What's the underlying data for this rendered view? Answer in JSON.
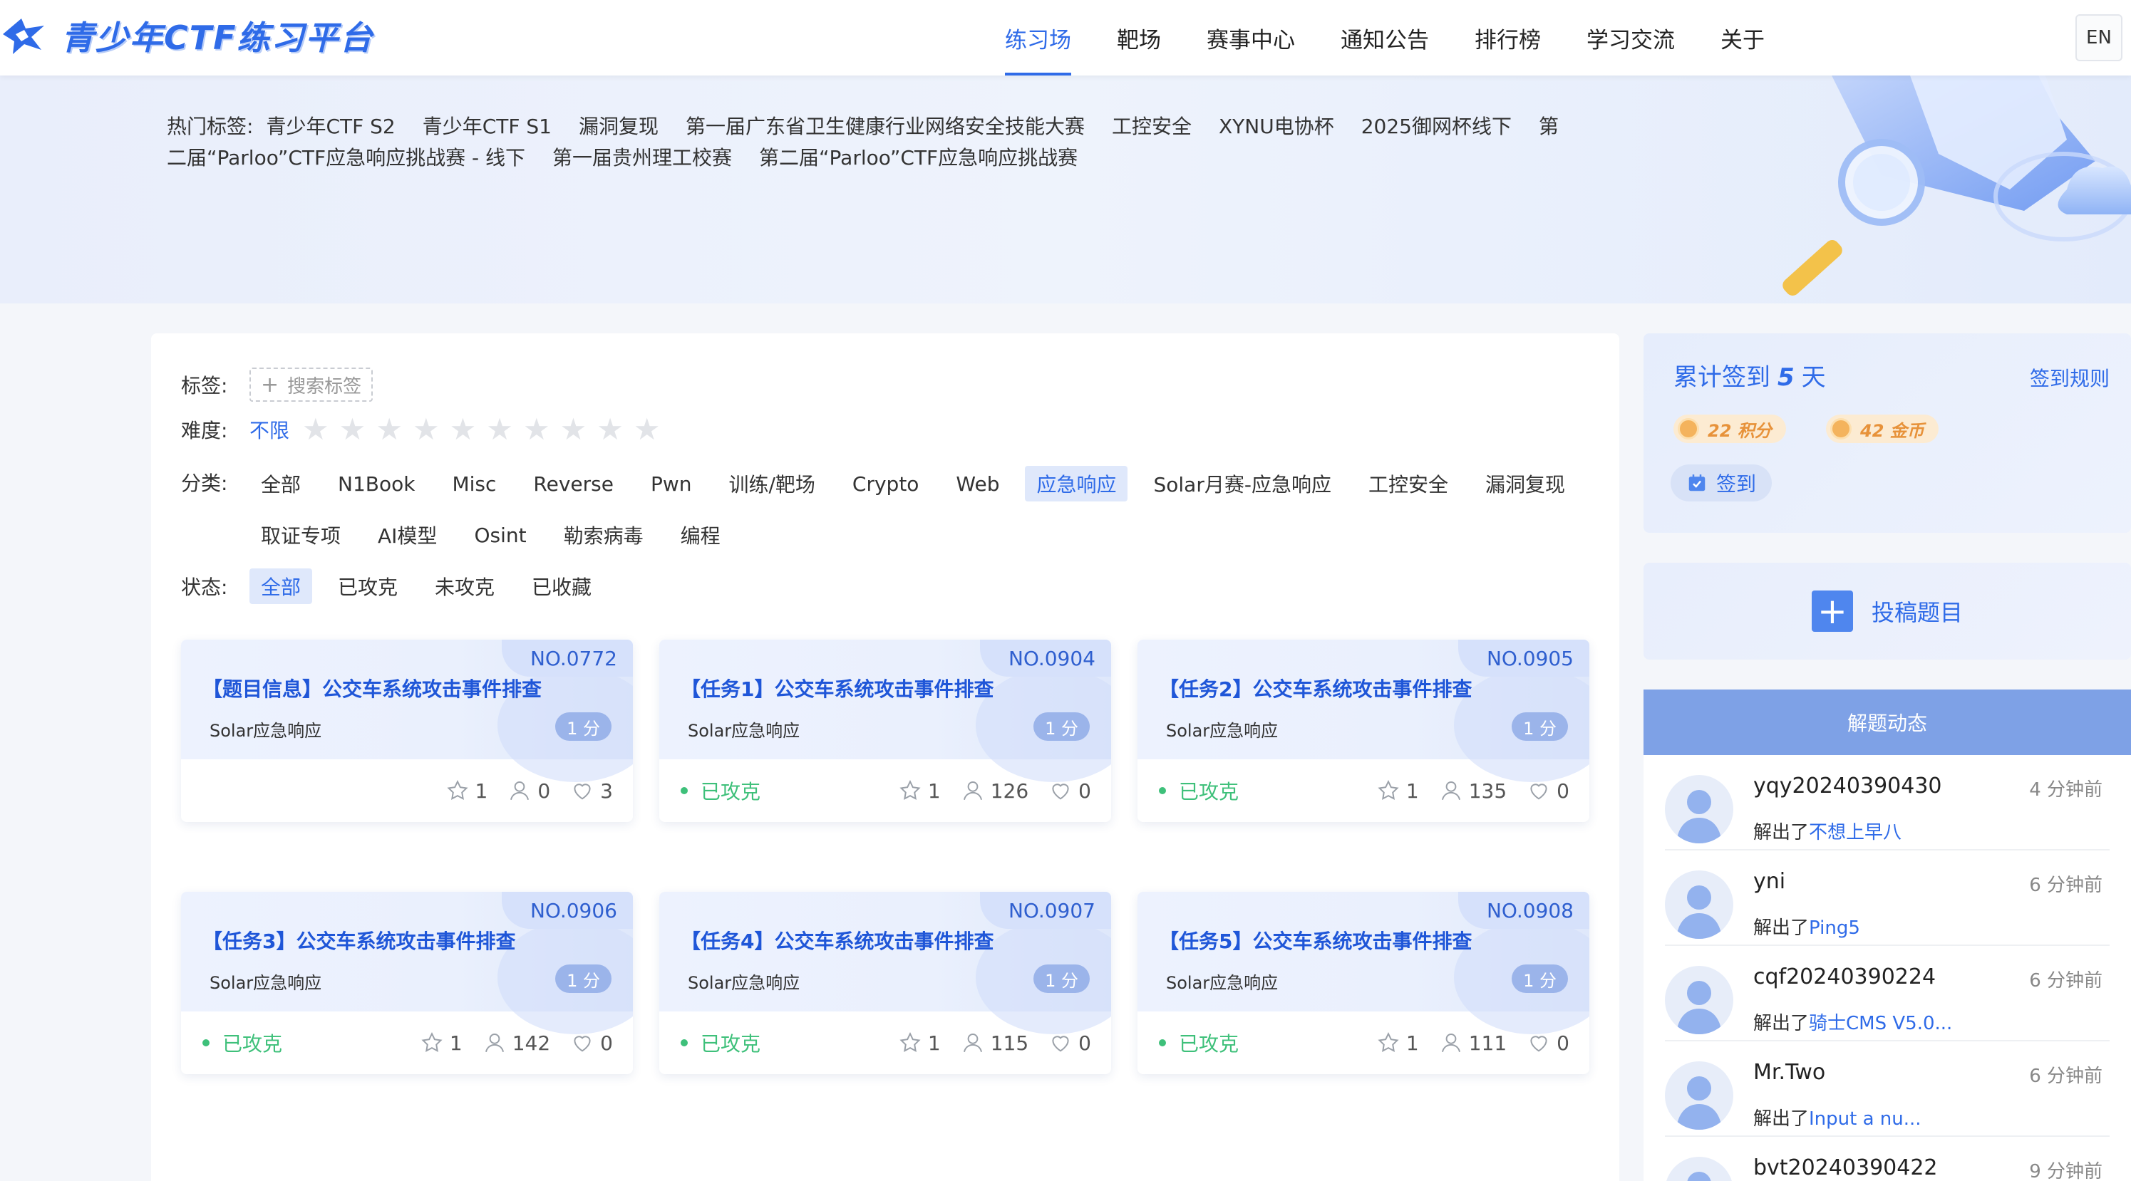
{
  "header": {
    "logo_text": "青少年CTF练习平台",
    "nav": [
      {
        "label": "练习场",
        "active": true
      },
      {
        "label": "靶场"
      },
      {
        "label": "赛事中心"
      },
      {
        "label": "通知公告"
      },
      {
        "label": "排行榜"
      },
      {
        "label": "学习交流"
      },
      {
        "label": "关于"
      }
    ],
    "lang": "EN"
  },
  "hot_tags": {
    "label": "热门标签:",
    "tags": [
      "青少年CTF S2",
      "青少年CTF S1",
      "漏洞复现",
      "第一届广东省卫生健康行业网络安全技能大赛",
      "工控安全",
      "XYNU电协杯",
      "2025御网杯线下",
      "第二届“Parloo”CTF应急响应挑战赛 - 线下",
      "第一届贵州理工校赛",
      "第二届“Parloo”CTF应急响应挑战赛"
    ]
  },
  "filters": {
    "tag_label": "标签:",
    "tag_search": "搜索标签",
    "difficulty_label": "难度:",
    "difficulty_any": "不限",
    "category_label": "分类:",
    "categories": [
      "全部",
      "N1Book",
      "Misc",
      "Reverse",
      "Pwn",
      "训练/靶场",
      "Crypto",
      "Web",
      "应急响应",
      "Solar月赛-应急响应",
      "工控安全",
      "漏洞复现",
      "取证专项",
      "AI模型",
      "Osint",
      "勒索病毒",
      "编程"
    ],
    "active_category": "应急响应",
    "status_label": "状态:",
    "statuses": [
      "全部",
      "已攻克",
      "未攻克",
      "已收藏"
    ],
    "active_status": "全部"
  },
  "cards": [
    {
      "no": "NO.0772",
      "title": "【题目信息】公交车系统攻击事件排查",
      "category": "Solar应急响应",
      "score": "1 分",
      "solved": "",
      "stars": "1",
      "users": "0",
      "likes": "3"
    },
    {
      "no": "NO.0904",
      "title": "【任务1】公交车系统攻击事件排查",
      "category": "Solar应急响应",
      "score": "1 分",
      "solved": "已攻克",
      "stars": "1",
      "users": "126",
      "likes": "0"
    },
    {
      "no": "NO.0905",
      "title": "【任务2】公交车系统攻击事件排查",
      "category": "Solar应急响应",
      "score": "1 分",
      "solved": "已攻克",
      "stars": "1",
      "users": "135",
      "likes": "0"
    },
    {
      "no": "NO.0906",
      "title": "【任务3】公交车系统攻击事件排查",
      "category": "Solar应急响应",
      "score": "1 分",
      "solved": "已攻克",
      "stars": "1",
      "users": "142",
      "likes": "0"
    },
    {
      "no": "NO.0907",
      "title": "【任务4】公交车系统攻击事件排查",
      "category": "Solar应急响应",
      "score": "1 分",
      "solved": "已攻克",
      "stars": "1",
      "users": "115",
      "likes": "0"
    },
    {
      "no": "NO.0908",
      "title": "【任务5】公交车系统攻击事件排查",
      "category": "Solar应急响应",
      "score": "1 分",
      "solved": "已攻克",
      "stars": "1",
      "users": "111",
      "likes": "0"
    }
  ],
  "signin": {
    "title_pre": "累计签到",
    "days": "5",
    "title_post": "天",
    "rules": "签到规则",
    "points": "22 积分",
    "coins": "42 金币",
    "button": "签到"
  },
  "submit": {
    "label": "投稿题目"
  },
  "feed": {
    "title": "解题动态",
    "solved_prefix": "解出了",
    "items": [
      {
        "user": "yqy20240390430",
        "time": "4 分钟前",
        "challenge": "不想上早八"
      },
      {
        "user": "yni",
        "time": "6 分钟前",
        "challenge": "Ping5"
      },
      {
        "user": "cqf20240390224",
        "time": "6 分钟前",
        "challenge": "骑士CMS V5.0..."
      },
      {
        "user": "Mr.Two",
        "time": "6 分钟前",
        "challenge": "Input a nu..."
      },
      {
        "user": "bvt20240390422",
        "time": "9 分钟前",
        "challenge": ""
      }
    ]
  },
  "colors": {
    "primary": "#2f6be8",
    "solved": "#3ec07a",
    "feed_header": "#7ea1e6"
  }
}
